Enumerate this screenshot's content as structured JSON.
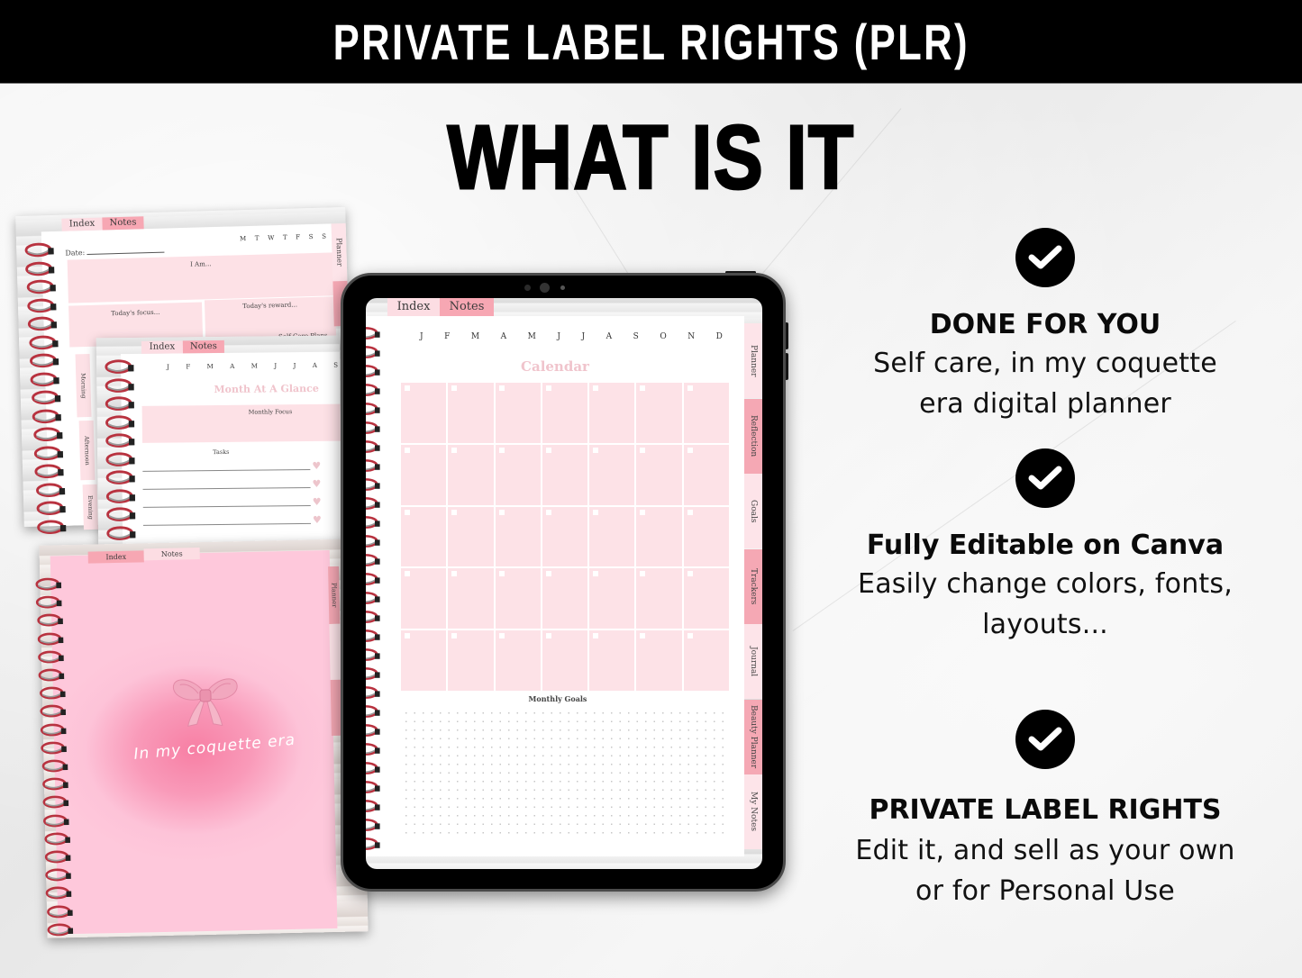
{
  "banner": {
    "title": "PRIVATE LABEL RIGHTS (PLR)"
  },
  "heading": "WHAT IS IT",
  "features": [
    {
      "icon": "check-circle-icon",
      "title": "DONE FOR YOU",
      "desc_lines": [
        "Self care, in my coquette",
        "era digital planner"
      ]
    },
    {
      "icon": "check-circle-icon",
      "title": "Fully Editable on Canva",
      "desc_lines": [
        "Easily change colors, fonts,",
        "layouts..."
      ]
    },
    {
      "icon": "check-circle-icon",
      "title": "PRIVATE LABEL RIGHTS",
      "desc_lines": [
        "Edit it, and sell as your own",
        "or for Personal Use"
      ]
    }
  ],
  "daily_page": {
    "tabs": [
      "Index",
      "Notes"
    ],
    "date_label": "Date:",
    "weekdays": [
      "M",
      "T",
      "W",
      "T",
      "F",
      "S",
      "S"
    ],
    "i_am": "I Am...",
    "focus": "Today's focus...",
    "reward": "Today's reward...",
    "self_care": "Self Care Plans",
    "side_tab": "Planner",
    "time_tabs": [
      "Morning",
      "Afternoon",
      "Evening"
    ]
  },
  "month_page": {
    "tabs": [
      "Index",
      "Notes"
    ],
    "months": [
      "J",
      "F",
      "M",
      "A",
      "M",
      "J",
      "J",
      "A",
      "S"
    ],
    "title": "Month At A Glance",
    "focus": "Monthly Focus",
    "tasks": "Tasks"
  },
  "cover_page": {
    "tabs": [
      "Index",
      "Notes"
    ],
    "side_tab": "Planner",
    "tagline": "In my coquette era"
  },
  "tablet": {
    "tabs": [
      "Index",
      "Notes"
    ],
    "months": [
      "J",
      "F",
      "M",
      "A",
      "M",
      "J",
      "J",
      "A",
      "S",
      "O",
      "N",
      "D"
    ],
    "title": "Calendar",
    "goals": "Monthly Goals",
    "side_tabs": [
      "Planner",
      "Reflection",
      "Goals",
      "Trackers",
      "Journal",
      "Beauty Planner",
      "My Notes"
    ]
  },
  "colors": {
    "banner_bg": "#000000",
    "pink_light": "#fde1e6",
    "pink_tab": "#f7a7b3",
    "title_pink": "#f0c4cc",
    "ring_red": "#b8323f"
  }
}
